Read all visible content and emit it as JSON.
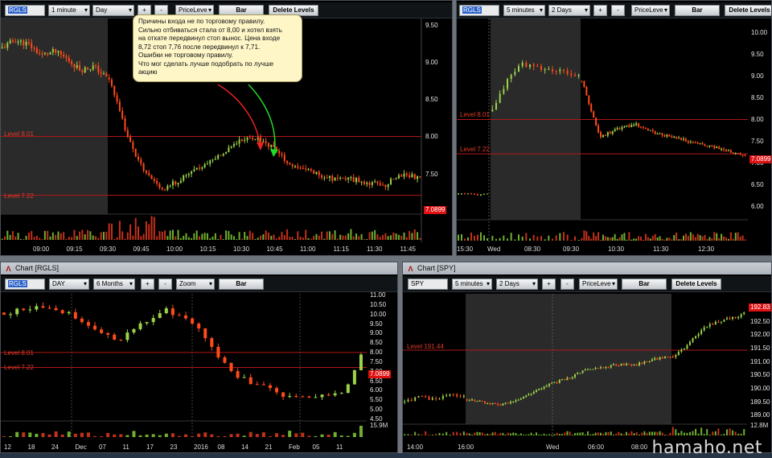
{
  "panels": {
    "tl": {
      "ticker": "RGLS",
      "interval": "1 minute",
      "range": "Day",
      "plus": "+",
      "minus": "-",
      "price_mode": "PriceLeve",
      "bar": "Bar",
      "delete_levels": "Delete Levels",
      "y_ticks": [
        "9.50",
        "9.00",
        "8.50",
        "8.00",
        "7.50"
      ],
      "x_ticks": [
        "09:00",
        "09:15",
        "09:30",
        "09:45",
        "10:00",
        "10:15",
        "10:30",
        "10:45",
        "11:00",
        "11:15",
        "11:30",
        "11:45"
      ],
      "level1": "Level 8.01",
      "level2": "Level 7.22",
      "last_price": "7.0899",
      "note_lines": [
        "Причины входа не по торговому правилу.",
        "Сильно отбиваться стала от 8,00 и хотел взять",
        "на откате передвинул стоп вынос. Цена входе",
        "8,72 стоп 7,76 после передвинул к 7,71.",
        "Ошибки не торговому правилу.",
        "Что мог сделать лучше подобрать по лучше",
        "акцию"
      ]
    },
    "tr": {
      "ticker": "RGLS",
      "interval": "5 minutes",
      "range": "2 Days",
      "plus": "+",
      "minus": "-",
      "price_mode": "PriceLeve",
      "bar": "Bar",
      "delete_levels": "Delete Levels",
      "y_ticks": [
        "10.00",
        "9.50",
        "9.00",
        "8.50",
        "8.00",
        "7.50",
        "7.00",
        "6.50",
        "6.00"
      ],
      "x_ticks": [
        "15:30",
        "Wed",
        "08:30",
        "09:30",
        "10:30",
        "11:30",
        "12:30"
      ],
      "level1": "Level 8.01",
      "level2": "Level 7.22",
      "last_price": "7.0899"
    },
    "bl": {
      "window_title": "Chart [RGLS]",
      "ticker": "RGLS",
      "interval": "DAY",
      "range": "6 Months",
      "plus": "+",
      "minus": "-",
      "price_mode": "Zoom",
      "bar": "Bar",
      "y_ticks": [
        "11.00",
        "10.50",
        "10.00",
        "9.50",
        "9.00",
        "8.50",
        "8.00",
        "7.50",
        "7.00",
        "6.50",
        "6.00",
        "5.50",
        "5.00",
        "4.50"
      ],
      "x_ticks": [
        "12",
        "18",
        "24",
        "Dec",
        "07",
        "11",
        "17",
        "23",
        "2016",
        "08",
        "14",
        "21",
        "Feb",
        "05",
        "11"
      ],
      "level1": "Level 8.01",
      "level2": "Level 7.22",
      "last_price": "7.0899",
      "volume_label": "15.9M"
    },
    "br": {
      "window_title": "Chart [SPY]",
      "ticker": "SPY",
      "interval": "5 minutes",
      "range": "2 Days",
      "plus": "+",
      "minus": "-",
      "price_mode": "PriceLeve",
      "bar": "Bar",
      "delete_levels": "Delete Levels",
      "y_ticks": [
        "193.00",
        "192.50",
        "192.00",
        "191.50",
        "191.00",
        "190.50",
        "190.00",
        "189.50",
        "189.00"
      ],
      "x_ticks": [
        "14:00",
        "16:00",
        "Wed",
        "06:00",
        "08:00"
      ],
      "level1": "Level 191.44",
      "last_price": "192.83",
      "volume_label": "12.8M"
    }
  },
  "watermark": "hamaho.net",
  "colors": {
    "up": "#9bd24a",
    "down": "#ff4a1a",
    "level": "#b01818",
    "premarket": "#2a2a2a"
  }
}
